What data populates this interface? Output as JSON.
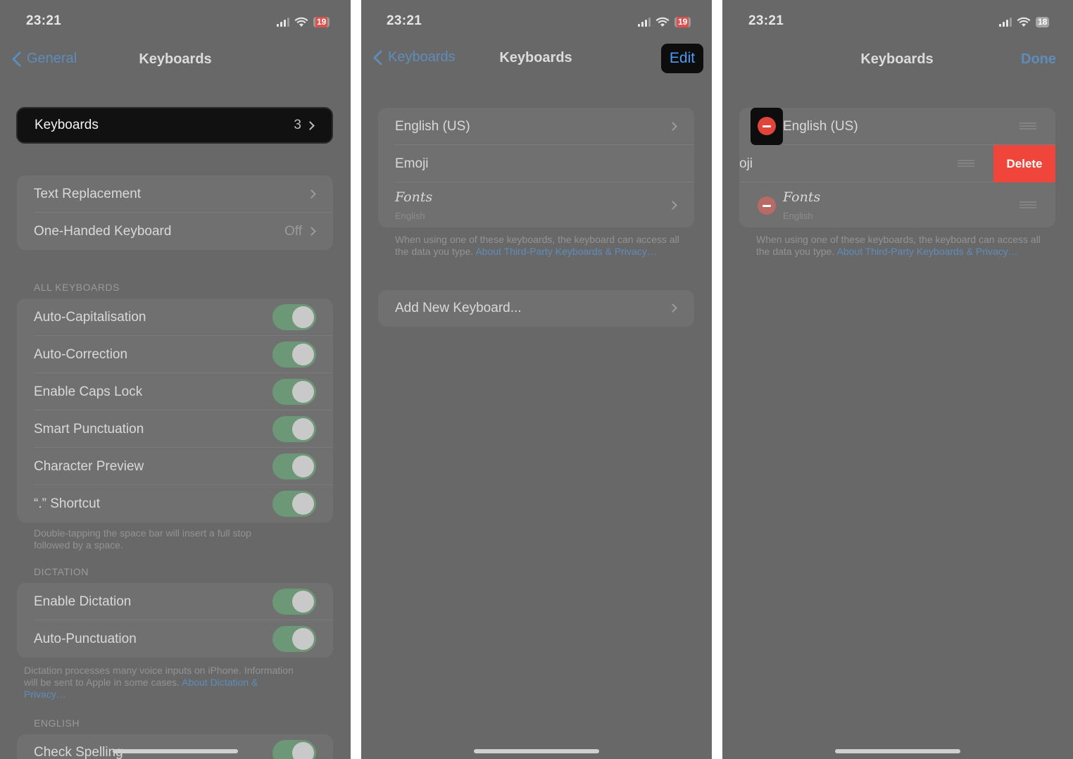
{
  "colors": {
    "accent": "#5f8cba",
    "toggle_on": "#6d9877",
    "destructive": "#e0453b",
    "dim_overlay": "#686868",
    "highlight": "#111111"
  },
  "panel1": {
    "status": {
      "time": "23:21",
      "battery": "19"
    },
    "nav": {
      "back": "General",
      "title": "Keyboards"
    },
    "keyboards_row": {
      "label": "Keyboards",
      "value": "3"
    },
    "group1": [
      {
        "label": "Text Replacement",
        "value": ""
      },
      {
        "label": "One-Handed Keyboard",
        "value": "Off"
      }
    ],
    "all_keyboards_header": "ALL KEYBOARDS",
    "toggles": [
      {
        "label": "Auto-Capitalisation",
        "on": true
      },
      {
        "label": "Auto-Correction",
        "on": true
      },
      {
        "label": "Enable Caps Lock",
        "on": true
      },
      {
        "label": "Smart Punctuation",
        "on": true
      },
      {
        "label": "Character Preview",
        "on": true
      },
      {
        "label": "“.” Shortcut",
        "on": true
      }
    ],
    "shortcut_note_line1": "Double-tapping the space bar will insert a full stop",
    "shortcut_note_line2": "followed by a space.",
    "dictation_header": "DICTATION",
    "dictation_toggles": [
      {
        "label": "Enable Dictation",
        "on": true
      },
      {
        "label": "Auto-Punctuation",
        "on": true
      }
    ],
    "dictation_note_line1": "Dictation processes many voice inputs on iPhone. Information",
    "dictation_note_line2": "will be sent to Apple in some cases.",
    "dictation_note_link1": "About Dictation &",
    "dictation_note_link2": "Privacy…",
    "english_header": "ENGLISH",
    "check_spelling": "Check Spelling"
  },
  "panel2": {
    "status": {
      "time": "23:21",
      "battery": "19"
    },
    "nav": {
      "back": "Keyboards",
      "title": "Keyboards",
      "action": "Edit"
    },
    "keyboards": [
      {
        "label": "English (US)"
      },
      {
        "label": "Emoji"
      },
      {
        "label": "Fonts",
        "sub": "English"
      }
    ],
    "note_line1": "When using one of these keyboards, the keyboard can access all",
    "note_line2": "the data you type.",
    "note_link": "About Third-Party Keyboards & Privacy…",
    "add_keyboard": "Add New Keyboard..."
  },
  "panel3": {
    "status": {
      "time": "23:21",
      "battery": "18"
    },
    "nav": {
      "title": "Keyboards",
      "action": "Done"
    },
    "keyboards": [
      {
        "label": "English (US)"
      },
      {
        "label": "oji"
      },
      {
        "label": "Fonts",
        "sub": "English"
      }
    ],
    "delete_label": "Delete",
    "note_line1": "When using one of these keyboards, the keyboard can access all",
    "note_line2": "the data you type.",
    "note_link": "About Third-Party Keyboards & Privacy…"
  }
}
